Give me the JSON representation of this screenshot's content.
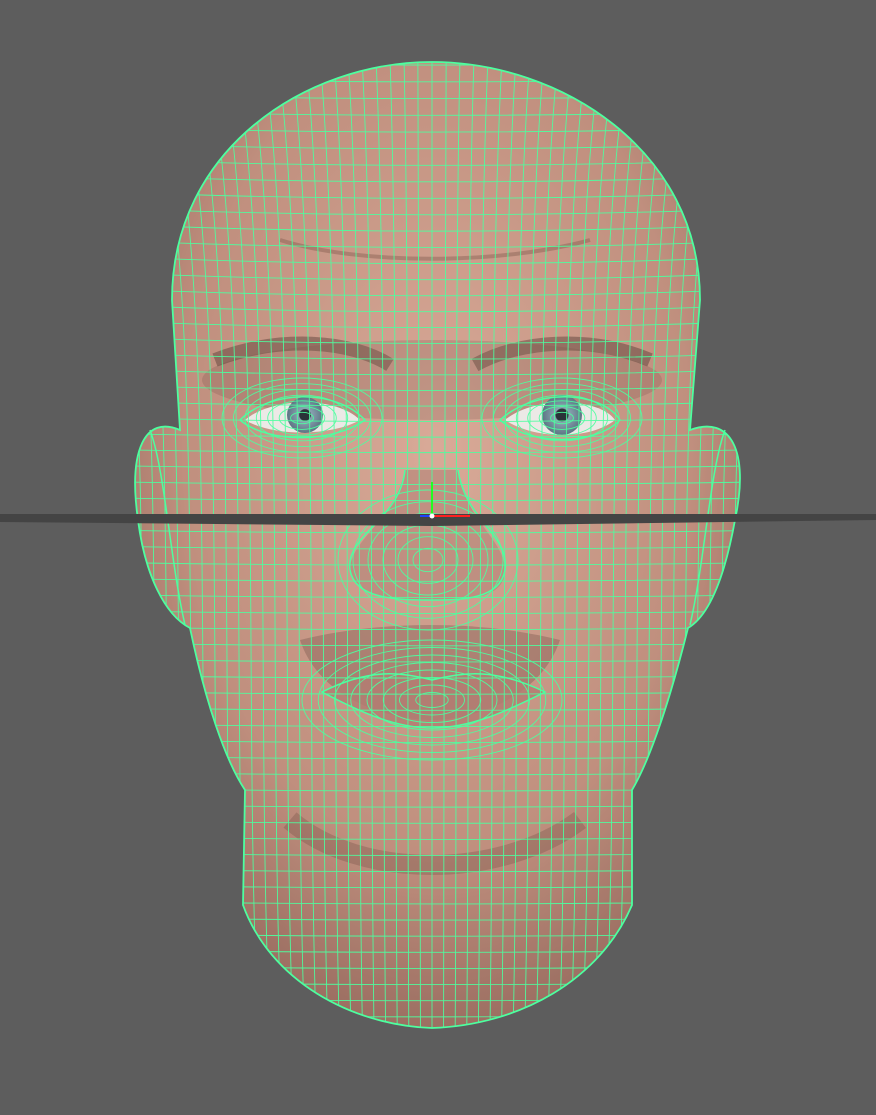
{
  "viewport": {
    "background": "#5d5d5d",
    "wireframe_color": "#4dff9f",
    "skin_color": "#c79a8a",
    "ground_plane_color": "#444444",
    "axis_colors": {
      "x": "#ff2020",
      "y": "#20ff20",
      "z": "#2040ff"
    },
    "iris_color": "#7f98a8"
  },
  "object": {
    "icon": "head-mesh-icon",
    "display_mode": "wireframe-on-shaded"
  }
}
